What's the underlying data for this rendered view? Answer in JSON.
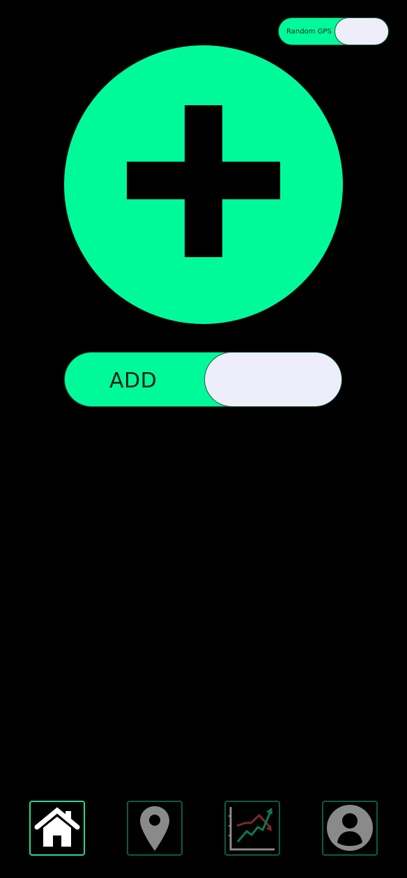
{
  "random_gps": {
    "label": "Random GPS"
  },
  "add_toggle": {
    "label": "ADD"
  },
  "icons": {
    "add": "plus-icon",
    "home": "home-icon",
    "map": "map-pin-icon",
    "stats": "chart-icon",
    "profile": "user-icon"
  },
  "colors": {
    "accent": "#00FA9A",
    "knob": "#EEEEFB",
    "background": "#000000",
    "nav_border": "#0c5c40",
    "nav_active_border": "#2bd694",
    "icon_inactive": "#8a8a8a",
    "icon_active": "#ffffff"
  },
  "nav": {
    "active": "home"
  }
}
